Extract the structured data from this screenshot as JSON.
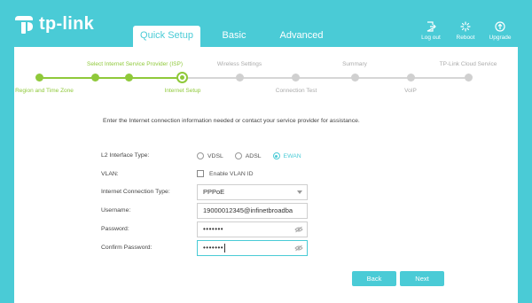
{
  "brand": {
    "name": "tp-link"
  },
  "tabs": [
    {
      "label": "Quick Setup",
      "active": true
    },
    {
      "label": "Basic",
      "active": false
    },
    {
      "label": "Advanced",
      "active": false
    }
  ],
  "header_actions": {
    "logout": "Log out",
    "reboot": "Reboot",
    "upgrade": "Upgrade"
  },
  "steps": [
    {
      "label": "Region and Time Zone",
      "state": "done"
    },
    {
      "label": "Select Internet Service Provider (ISP)",
      "state": "done"
    },
    {
      "label": "Internet Setup",
      "state": "current"
    },
    {
      "label": "Wireless Settings",
      "state": "todo"
    },
    {
      "label": "Connection Test",
      "state": "todo"
    },
    {
      "label": "Summary",
      "state": "todo"
    },
    {
      "label": "VoIP",
      "state": "todo"
    },
    {
      "label": "TP-Link Cloud Service",
      "state": "todo"
    }
  ],
  "intro": "Enter the Internet connection information needed or contact your service provider for assistance.",
  "form": {
    "l2_label": "L2 Interface Type:",
    "l2_options": [
      "VDSL",
      "ADSL",
      "EWAN"
    ],
    "l2_selected": "EWAN",
    "vlan_label": "VLAN:",
    "vlan_checkbox": "Enable VLAN ID",
    "vlan_checked": false,
    "conn_type_label": "Internet Connection Type:",
    "conn_type_value": "PPPoE",
    "username_label": "Username:",
    "username_value": "19000012345@infinetbroadba",
    "password_label": "Password:",
    "password_value": "•••••••",
    "confirm_label": "Confirm Password:",
    "confirm_value": "•••••••"
  },
  "buttons": {
    "back": "Back",
    "next": "Next"
  },
  "colors": {
    "accent": "#4acbd6",
    "progress": "#8fc93a"
  }
}
